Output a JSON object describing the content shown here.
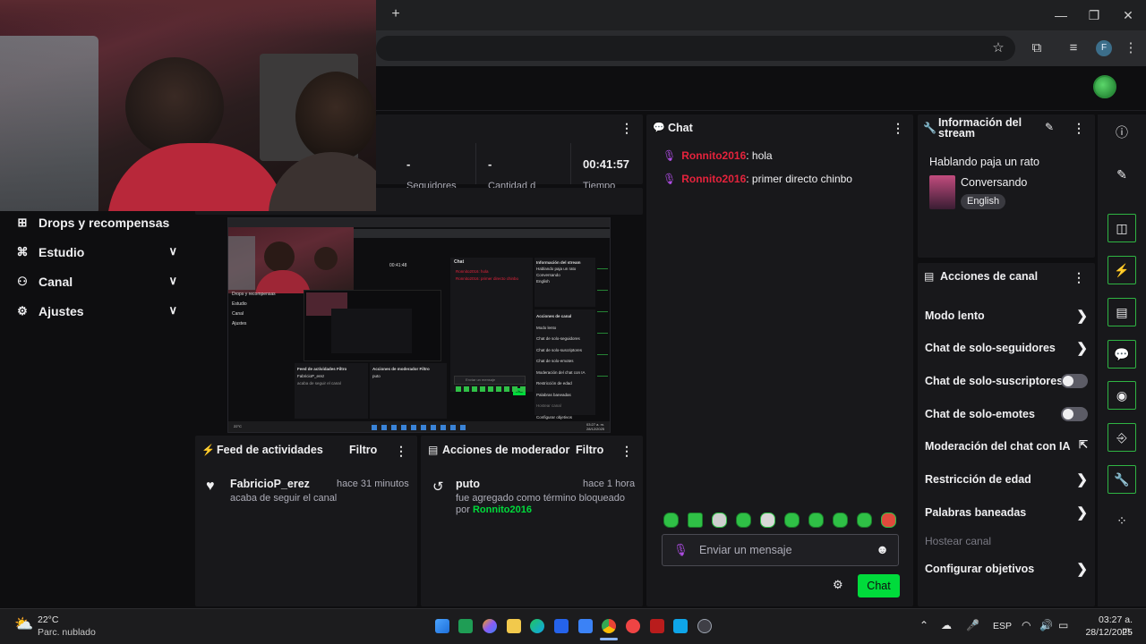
{
  "browser": {
    "new_tab": "+",
    "minimize": "—",
    "restore": "❐",
    "close": "✕",
    "profile_initial": "F"
  },
  "stats": {
    "followers_value": "-",
    "followers_label": "Seguidores",
    "count_value": "-",
    "count_label": "Cantidad d",
    "time_value": "00:41:57",
    "time_label": "Tiempo"
  },
  "nav": {
    "items": [
      {
        "label": "Drops y recompensas"
      },
      {
        "label": "Estudio"
      },
      {
        "label": "Canal"
      },
      {
        "label": "Ajustes"
      }
    ]
  },
  "preview": {
    "nav_items": [
      "Drops y recompensas",
      "Estudio",
      "Canal",
      "Ajustes"
    ],
    "chat_title": "Chat",
    "chat_lines": [
      "Ronnito2016: hola",
      "Ronnito2016: primer directo chinbo"
    ],
    "info_title": "Información del stream",
    "info_stream_title": "Hablando paja un rato",
    "info_category": "Conversando",
    "info_lang": "English",
    "actions_title": "Acciones de canal",
    "actions": [
      "Modo lento",
      "Chat de solo-seguidores",
      "Chat de solo-suscriptores",
      "Chat de solo-emotes",
      "Moderación del chat con IA",
      "Restricción de edad",
      "Palabras baneadas",
      "Hostear canal",
      "Configurar objetivos"
    ],
    "feed_title": "Feed de actividades",
    "feed_filter": "Filtro",
    "feed_user": "FabricioP_erez",
    "feed_desc": "acaba de seguir el canal",
    "mod_title": "Acciones de moderador",
    "mod_filter": "Filtro",
    "mod_word": "puto",
    "chat_placeholder": "Enviar un mensaje",
    "chat_button": "Chat",
    "clock": "03:27 a. m.",
    "date": "28/12/2025",
    "stat_time": "00:41:48",
    "weather": "22°C"
  },
  "chat": {
    "title": "Chat",
    "messages": [
      {
        "user": "Ronnito2016",
        "text": ": hola"
      },
      {
        "user": "Ronnito2016",
        "text": ": primer directo chinbo"
      }
    ],
    "input_placeholder": "Enviar un mensaje",
    "send_label": "Chat"
  },
  "stream_info": {
    "title": "Información del stream",
    "stream_title": "Hablando paja un rato",
    "category": "Conversando",
    "language": "English"
  },
  "channel_actions": {
    "title": "Acciones de canal",
    "items": [
      {
        "label": "Modo lento",
        "control": "chevron"
      },
      {
        "label": "Chat de solo-seguidores",
        "control": "chevron"
      },
      {
        "label": "Chat de solo-suscriptores",
        "control": "toggle",
        "on": false
      },
      {
        "label": "Chat de solo-emotes",
        "control": "toggle",
        "on": false
      },
      {
        "label": "Moderación del chat con IA",
        "control": "external"
      },
      {
        "label": "Restricción de edad",
        "control": "chevron"
      },
      {
        "label": "Palabras baneadas",
        "control": "chevron"
      },
      {
        "label": "Hostear canal",
        "control": "none",
        "disabled": true
      },
      {
        "label": "Configurar objetivos",
        "control": "chevron"
      }
    ]
  },
  "feed": {
    "title": "Feed de actividades",
    "filter": "Filtro",
    "user": "FabricioP_erez",
    "time": "hace 31 minutos",
    "desc": "acaba de seguir el canal"
  },
  "mod_actions": {
    "title": "Acciones de moderador",
    "filter": "Filtro",
    "word": "puto",
    "time": "hace 1 hora",
    "desc_line1": "fue agregado como término bloqueado",
    "desc_prefix": "por ",
    "moderator": "Ronnito2016"
  },
  "taskbar": {
    "temperature": "22°C",
    "weather": "Parc. nublado",
    "language": "ESP",
    "time": "03:27 a. m.",
    "date": "28/12/2025"
  },
  "colors": {
    "accent_green": "#00db3b",
    "username_red": "#e5233c",
    "mic_purple": "#b04de6",
    "panel_bg": "#18181b",
    "page_bg": "#0e0e10"
  }
}
